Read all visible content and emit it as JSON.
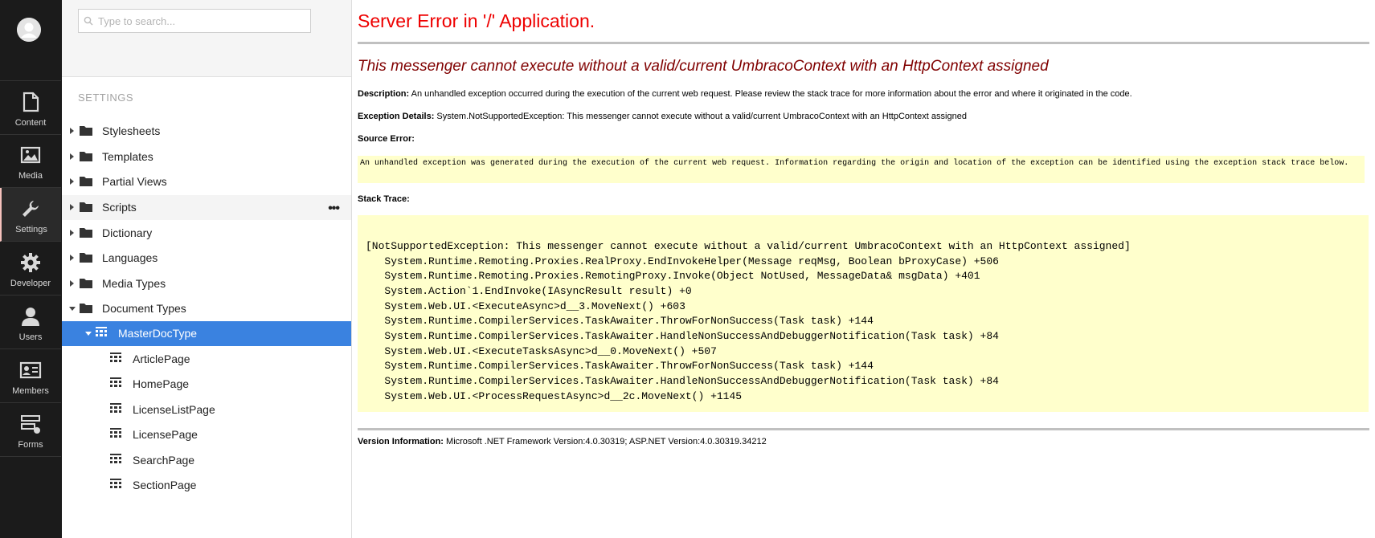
{
  "appbar": {
    "sections": [
      {
        "label": "Content",
        "icon": "document-icon"
      },
      {
        "label": "Media",
        "icon": "image-icon"
      },
      {
        "label": "Settings",
        "icon": "wrench-icon"
      },
      {
        "label": "Developer",
        "icon": "gear-icon"
      },
      {
        "label": "Users",
        "icon": "user-icon"
      },
      {
        "label": "Members",
        "icon": "id-card-icon"
      },
      {
        "label": "Forms",
        "icon": "forms-icon"
      }
    ],
    "active": "Settings"
  },
  "tree": {
    "search_placeholder": "Type to search...",
    "title": "SETTINGS",
    "nodes": [
      {
        "label": "Stylesheets"
      },
      {
        "label": "Templates"
      },
      {
        "label": "Partial Views"
      },
      {
        "label": "Scripts",
        "actions": "•••"
      },
      {
        "label": "Dictionary"
      },
      {
        "label": "Languages"
      },
      {
        "label": "Media Types"
      },
      {
        "label": "Document Types"
      }
    ],
    "selected": {
      "label": "MasterDocType"
    },
    "children": [
      {
        "label": "ArticlePage"
      },
      {
        "label": "HomePage"
      },
      {
        "label": "LicenseListPage"
      },
      {
        "label": "LicensePage"
      },
      {
        "label": "SearchPage"
      },
      {
        "label": "SectionPage"
      }
    ]
  },
  "error": {
    "title": "Server Error in '/' Application.",
    "subtitle": "This messenger cannot execute without a valid/current UmbracoContext with an HttpContext assigned",
    "description_label": "Description:",
    "description": "An unhandled exception occurred during the execution of the current web request. Please review the stack trace for more information about the error and where it originated in the code.",
    "details_label": "Exception Details:",
    "details": "System.NotSupportedException: This messenger cannot execute without a valid/current UmbracoContext with an HttpContext assigned",
    "source_label": "Source Error:",
    "source_text": "An unhandled exception was generated during the execution of the current web request. Information regarding the origin and location of the exception can be identified using the exception stack trace below.",
    "stack_label": "Stack Trace:",
    "stack": [
      "[NotSupportedException: This messenger cannot execute without a valid/current UmbracoContext with an HttpContext assigned]",
      "   System.Runtime.Remoting.Proxies.RealProxy.EndInvokeHelper(Message reqMsg, Boolean bProxyCase) +506",
      "   System.Runtime.Remoting.Proxies.RemotingProxy.Invoke(Object NotUsed, MessageData& msgData) +401",
      "   System.Action`1.EndInvoke(IAsyncResult result) +0",
      "   System.Web.UI.<ExecuteAsync>d__3.MoveNext() +603",
      "   System.Runtime.CompilerServices.TaskAwaiter.ThrowForNonSuccess(Task task) +144",
      "   System.Runtime.CompilerServices.TaskAwaiter.HandleNonSuccessAndDebuggerNotification(Task task) +84",
      "   System.Web.UI.<ExecuteTasksAsync>d__0.MoveNext() +507",
      "   System.Runtime.CompilerServices.TaskAwaiter.ThrowForNonSuccess(Task task) +144",
      "   System.Runtime.CompilerServices.TaskAwaiter.HandleNonSuccessAndDebuggerNotification(Task task) +84",
      "   System.Web.UI.<ProcessRequestAsync>d__2c.MoveNext() +1145"
    ],
    "version_label": "Version Information:",
    "version": "Microsoft .NET Framework Version:4.0.30319; ASP.NET Version:4.0.30319.34212"
  }
}
